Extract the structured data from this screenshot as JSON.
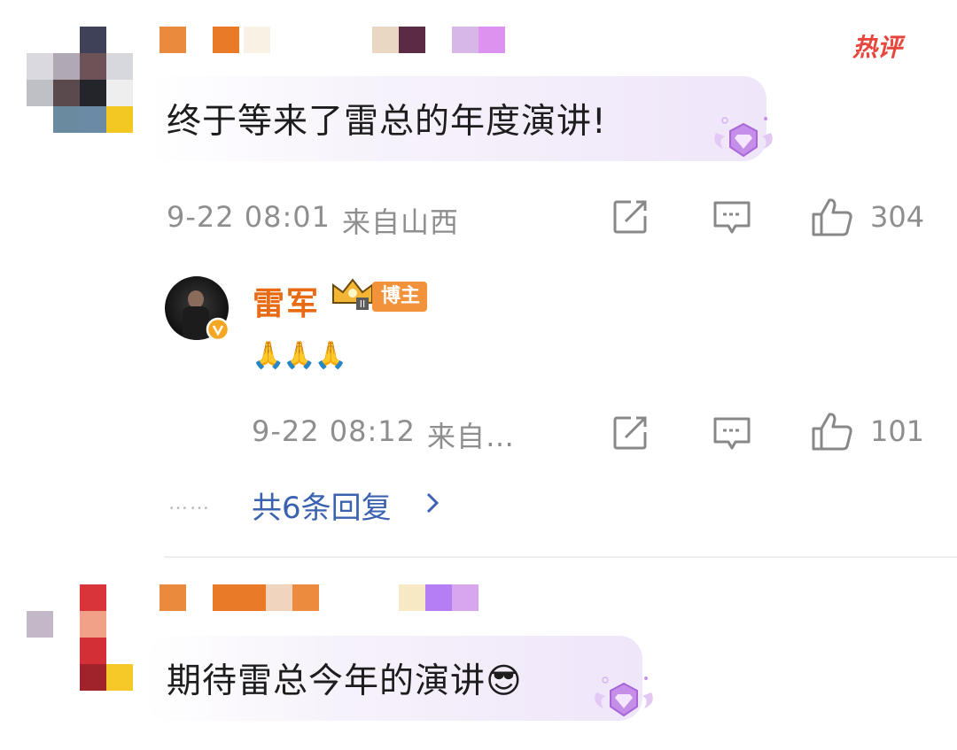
{
  "comments": [
    {
      "text": "终于等来了雷总的年度演讲!",
      "badge": "热评",
      "time": "9-22 08:01",
      "location": "来自山西",
      "likes": "304",
      "reply": {
        "author": "雷军",
        "author_tag": "博主",
        "text": "🙏🙏🙏",
        "time": "9-22 08:12",
        "location": "来自…",
        "likes": "101"
      },
      "more_replies": "共6条回复",
      "more_dots": "……"
    },
    {
      "text": "期待雷总今年的演讲😎"
    }
  ],
  "icons": [
    "hot-comment-badge",
    "share-icon",
    "comment-icon",
    "like-icon",
    "crown-icon",
    "verified-icon",
    "chevron-right-icon",
    "fan-badge-icon"
  ],
  "colors": {
    "accent_orange": "#e86a12",
    "link_blue": "#3b62b0",
    "meta_gray": "#8e8e8e",
    "hot_red": "#e8453c"
  }
}
